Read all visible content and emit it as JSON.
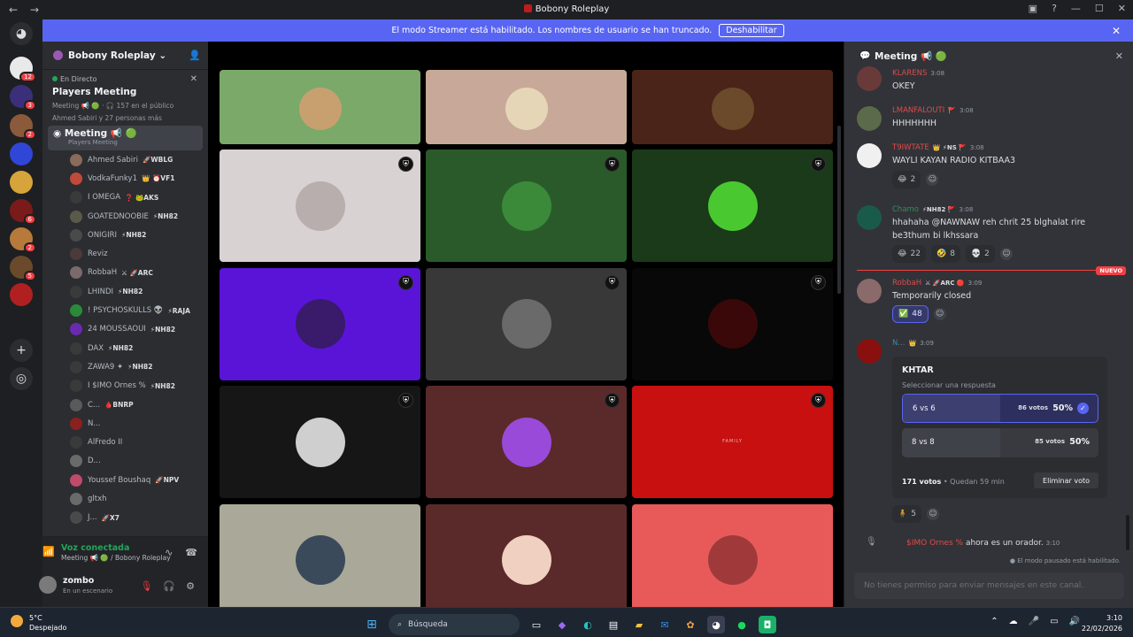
{
  "window": {
    "title": "Bobony Roleplay",
    "back": "←",
    "forward": "→"
  },
  "banner": {
    "text": "El modo Streamer está habilitado. Los nombres de usuario se han truncado.",
    "button": "Deshabilitar",
    "close": "✕"
  },
  "servers": [
    {
      "badge": "12",
      "color": "#e9e9e9"
    },
    {
      "badge": "3",
      "color": "#3b2f7a"
    },
    {
      "badge": "2",
      "color": "#8a5a3a"
    },
    {
      "badge": "",
      "color": "#3046d6"
    },
    {
      "badge": "",
      "color": "#d6a43a"
    },
    {
      "badge": "6",
      "color": "#7a1a1a"
    },
    {
      "badge": "2",
      "color": "#b87a3a"
    },
    {
      "badge": "5",
      "color": "#6a4a2a"
    },
    {
      "badge": "",
      "color": "#b02020"
    }
  ],
  "channels": {
    "guild_name": "Bobony Roleplay",
    "live_label": "En Directo",
    "stage_title": "Players Meeting",
    "stage_sub1": "Meeting 📢 🟢 · 🎧 157 en el público",
    "stage_sub2": "Ahmed Sabiri y 27 personas más",
    "active_channel": "Meeting 📢 🟢",
    "active_channel_sub": "Players Meeting",
    "members": [
      {
        "name": "Ahmed Sabiri",
        "tag": "🚀WBLG",
        "color": "#8a6a5a"
      },
      {
        "name": "VodkaFunky1",
        "tag": "👑 ⏰VF1",
        "color": "#c04a3a"
      },
      {
        "name": "I ΟΜΕGΑ",
        "tag": "❓ 🐸AKS",
        "color": "#3a3a3a"
      },
      {
        "name": "GOATEDNOOBIE",
        "tag": "⚡NH82",
        "color": "#5a5a4a"
      },
      {
        "name": "ONIGIRI",
        "tag": "⚡NH82",
        "color": "#4a4a4a"
      },
      {
        "name": "Reviz",
        "tag": "",
        "color": "#4a3a3a"
      },
      {
        "name": "RobbaH",
        "tag": "⚔ 🚀ARC",
        "color": "#7a6a6a"
      },
      {
        "name": "LHINDI",
        "tag": "⚡NH82",
        "color": "#3a3a3a"
      },
      {
        "name": "! PSYCHOSKULLS 👽",
        "tag": "⚡RAJA",
        "color": "#2a8a3a"
      },
      {
        "name": "24 MOUSSAOUI",
        "tag": "⚡NH82",
        "color": "#6a2ab0"
      },
      {
        "name": "DAX",
        "tag": "⚡NH82",
        "color": "#3a3a3a"
      },
      {
        "name": "ZAWA9 ✦",
        "tag": "⚡NH82",
        "color": "#3a3a3a"
      },
      {
        "name": "I $IMO Ornes %",
        "tag": "⚡NH82",
        "color": "#3a3a3a"
      },
      {
        "name": "C...",
        "tag": "🩸BNRP",
        "color": "#5a5a5a"
      },
      {
        "name": "N...",
        "tag": "",
        "color": "#8a2020"
      },
      {
        "name": "AlFredo II",
        "tag": "",
        "color": "#3a3a3a"
      },
      {
        "name": "D...",
        "tag": "",
        "color": "#6a6a6a"
      },
      {
        "name": "Youssef Boushaq",
        "tag": "🚀NPV",
        "color": "#c04a6a"
      },
      {
        "name": "gltxh",
        "tag": "",
        "color": "#6a6a6a"
      },
      {
        "name": "J...",
        "tag": "🚀X7",
        "color": "#4a4a4a"
      }
    ]
  },
  "voice": {
    "status": "Voz conectada",
    "channel": "Meeting 📢 🟢 / Bobony Roleplay",
    "user_name": "zombo",
    "user_status": "En un escenario"
  },
  "stage_tiles": [
    {
      "bg": "#7ba96a",
      "avatar": "#c8a070",
      "mod": false
    },
    {
      "bg": "#c8a898",
      "avatar": "#e6d6b8",
      "mod": false
    },
    {
      "bg": "#4a2418",
      "avatar": "#6a4a2a",
      "mod": false
    },
    {
      "bg": "#d8d2d2",
      "avatar": "#b8aeae",
      "mod": true
    },
    {
      "bg": "#2a5a2a",
      "avatar": "#3a8a3a",
      "mod": true
    },
    {
      "bg": "#1a3a1a",
      "avatar": "#4ac830",
      "mod": true
    },
    {
      "bg": "#5a14d8",
      "avatar": "#3a1a6a",
      "mod": true
    },
    {
      "bg": "#383838",
      "avatar": "#6a6a6a",
      "mod": true
    },
    {
      "bg": "#080808",
      "avatar": "#3a0808",
      "mod": true
    },
    {
      "bg": "#161616",
      "avatar": "#cfcfcf",
      "mod": true
    },
    {
      "bg": "#5a2a2a",
      "avatar": "#9a4ad8",
      "mod": true
    },
    {
      "bg": "#c81010",
      "avatar": "#c81010",
      "mod": true,
      "label": "FAMILY"
    },
    {
      "bg": "#aaa898",
      "avatar": "#3a4a5a",
      "mod": false
    },
    {
      "bg": "#5a2a2a",
      "avatar": "#f0d0c0",
      "mod": false
    },
    {
      "bg": "#e85a5a",
      "avatar": "#a03a3a",
      "mod": false
    }
  ],
  "chat": {
    "title": "Meeting 📢 🟢",
    "messages": [
      {
        "author": "KLARENS",
        "author_color": "#e04a4a",
        "tag": "",
        "time": "3:08",
        "text": "OKEY",
        "avatar": "#6a3a3a"
      },
      {
        "author": "LMANFALOUTI",
        "author_color": "#e04a4a",
        "tag": "🚩",
        "time": "3:08",
        "text": "HHHHHHH",
        "avatar": "#5a6a4a"
      },
      {
        "author": "T9IWTATE",
        "author_color": "#e04a4a",
        "tag": "👑 ⚡NS 🚩",
        "time": "3:08",
        "text": "WAYLI KAYAN RADIO KITBAA3",
        "avatar": "#f0f0f0"
      },
      {
        "author": "Chamo",
        "author_color": "#3a8a5a",
        "tag": "⚡NH82 🚩",
        "time": "3:08",
        "text": "hhahaha @NAWNAW reh chrit 25 blghalat rire",
        "text2": "be3thum bi lkhssara",
        "avatar": "#1a5a4a"
      },
      {
        "author": "RobbaH",
        "author_color": "#e04a4a",
        "tag": "⚔ 🚀ARC 🔴",
        "time": "3:09",
        "text": "Temporarily closed",
        "avatar": "#8a6a6a"
      },
      {
        "author": "N...",
        "author_color": "#3a8aa8",
        "tag": "👑",
        "time": "3:09",
        "text": "",
        "avatar": "#8a1010"
      }
    ],
    "reactions": {
      "m3": [
        {
          "emoji": "😂",
          "count": "2"
        }
      ],
      "m4": [
        {
          "emoji": "😂",
          "count": "22"
        },
        {
          "emoji": "🤣",
          "count": "8"
        },
        {
          "emoji": "💀",
          "count": "2"
        }
      ],
      "m5": [
        {
          "emoji": "✅",
          "count": "48"
        }
      ],
      "m6": [
        {
          "emoji": "🧍",
          "count": "5"
        }
      ]
    },
    "new_label": "NUEVO",
    "poll": {
      "question": "KHTAR",
      "select": "Seleccionar una respuesta",
      "options": [
        {
          "label": "6 vs 6",
          "votes": "86 votos",
          "pct": "50%",
          "fill": 0.5
        },
        {
          "label": "8 vs 8",
          "votes": "85 votos",
          "pct": "50%",
          "fill": 0.5
        }
      ],
      "total": "171 votos",
      "remaining": "Quedan 59 min",
      "remove": "Eliminar voto"
    },
    "system_msg": {
      "name": "$IMO Ornes %",
      "text": "ahora es un orador.",
      "time": "3:10"
    },
    "paused": "El modo pausado está habilitado.",
    "input_placeholder": "No tienes permiso para enviar mensajes en este canal."
  },
  "taskbar": {
    "temp": "5°C",
    "weather": "Despejado",
    "search": "Búsqueda",
    "time": "3:10",
    "date": "22/02/2026"
  }
}
